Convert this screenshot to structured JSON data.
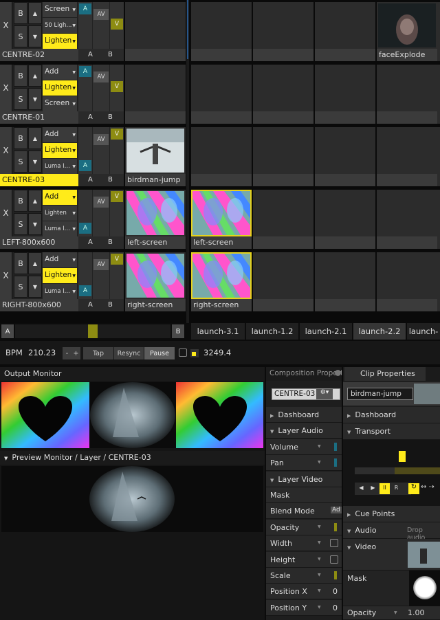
{
  "layers": [
    {
      "name": "CENTRE-02",
      "modes": [
        "Screen",
        "50 Ligh...",
        "Lighten"
      ],
      "mode_sel": 2,
      "a_pos": "top",
      "v_pos": "mid",
      "selected": false,
      "clips": [
        {
          "label": ""
        },
        {
          "label": ""
        },
        {
          "label": ""
        },
        {
          "label": ""
        },
        {
          "label": "faceExplode",
          "thumb": "face"
        }
      ]
    },
    {
      "name": "CENTRE-01",
      "modes": [
        "Add",
        "Lighten",
        "Screen"
      ],
      "mode_sel": 1,
      "a_pos": "top",
      "v_pos": "mid",
      "selected": false,
      "clips": [
        {
          "label": ""
        },
        {
          "label": ""
        },
        {
          "label": ""
        },
        {
          "label": ""
        },
        {
          "label": ""
        }
      ]
    },
    {
      "name": "CENTRE-03",
      "modes": [
        "Add",
        "Lighten",
        "Luma I..."
      ],
      "mode_sel": 1,
      "a_pos": "bot",
      "v_pos": "top",
      "selected": true,
      "clips": [
        {
          "label": "birdman-jump",
          "thumb": "bird"
        },
        {
          "label": ""
        },
        {
          "label": ""
        },
        {
          "label": ""
        },
        {
          "label": ""
        }
      ]
    },
    {
      "name": "LEFT-800x600",
      "modes": [
        "Add",
        "Lighten",
        "Luma I..."
      ],
      "mode_sel": 0,
      "a_pos": "bot",
      "v_pos": "top",
      "selected": false,
      "clips": [
        {
          "label": "left-screen",
          "thumb": "rainbow"
        },
        {
          "label": "left-screen",
          "thumb": "rainbow",
          "sel": true
        },
        {
          "label": ""
        },
        {
          "label": ""
        },
        {
          "label": ""
        }
      ]
    },
    {
      "name": "RIGHT-800x600",
      "modes": [
        "Add",
        "Lighten",
        "Luma I..."
      ],
      "mode_sel": 1,
      "a_pos": "bot",
      "v_pos": "top",
      "selected": false,
      "clips": [
        {
          "label": "right-screen",
          "thumb": "rainbow"
        },
        {
          "label": "right-screen",
          "thumb": "rainbow",
          "sel": true
        },
        {
          "label": ""
        },
        {
          "label": ""
        },
        {
          "label": ""
        }
      ]
    }
  ],
  "ctl": {
    "x": "X",
    "b": "B",
    "s": "S",
    "a": "A",
    "av": "AV",
    "v": "V",
    "bar_a": "A",
    "bar_b": "B"
  },
  "deck": {
    "a": "A",
    "b": "B",
    "tabs": [
      "launch-3.1",
      "launch-1.2",
      "launch-2.1",
      "launch-2.2",
      "launch-"
    ],
    "active_tab": 3
  },
  "bpm": {
    "label": "BPM",
    "value": "210.23",
    "minus": "-",
    "plus": "+",
    "tap": "Tap",
    "resync": "Resync",
    "pause": "Pause",
    "beats": "3249.4"
  },
  "output": {
    "title": "Output Monitor",
    "preview_title": "Preview Monitor / Layer / CENTRE-03"
  },
  "composition": {
    "title": "Composition Propert",
    "layer_select": "CENTRE-03",
    "rows": [
      {
        "label": "Dashboard",
        "type": "section"
      },
      {
        "label": "Layer Audio",
        "type": "section-open"
      },
      {
        "label": "Volume",
        "type": "prop",
        "ctrl": "blue"
      },
      {
        "label": "Pan",
        "type": "prop",
        "ctrl": "blue"
      },
      {
        "label": "Layer Video",
        "type": "section-open"
      },
      {
        "label": "Mask",
        "type": "plain"
      },
      {
        "label": "Blend Mode",
        "type": "plain",
        "value": "Ad"
      },
      {
        "label": "Opacity",
        "type": "prop",
        "ctrl": "yellow"
      },
      {
        "label": "Width",
        "type": "prop",
        "ctrl": "check"
      },
      {
        "label": "Height",
        "type": "prop",
        "ctrl": "check"
      },
      {
        "label": "Scale",
        "type": "prop",
        "ctrl": "yellow"
      },
      {
        "label": "Position X",
        "type": "prop",
        "value": "0"
      },
      {
        "label": "Position Y",
        "type": "prop",
        "value": "0"
      }
    ]
  },
  "clip": {
    "title": "Clip Properties",
    "clip_name": "birdman-jump",
    "dashboard": "Dashboard",
    "transport": "Transport",
    "transport_buttons": [
      "◀",
      "▶",
      "II",
      "R"
    ],
    "cue_points": "Cue Points",
    "audio": "Audio",
    "audio_hint": "Drop audio",
    "video": "Video",
    "mask": "Mask",
    "opacity": "Opacity",
    "opacity_value": "1.00"
  },
  "colors": {
    "accent_yellow": "#ffeb1a",
    "a_blue": "#1b6e82",
    "v_olive": "#8d8c12"
  }
}
